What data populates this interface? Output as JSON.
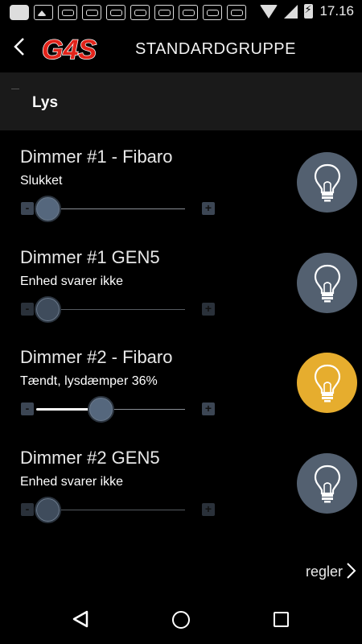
{
  "status_bar": {
    "time": "17.16",
    "icons": [
      "message-icon",
      "image-icon",
      "notification-icon",
      "notification-icon",
      "notification-icon",
      "notification-icon",
      "notification-icon",
      "notification-icon",
      "notification-icon",
      "notification-icon",
      "wifi-icon",
      "signal-icon",
      "battery-charging-icon"
    ]
  },
  "header": {
    "back_icon": "chevron-left-icon",
    "logo_text": "G4S",
    "title": "STANDARDGRUPPE"
  },
  "section": {
    "title": "Lys"
  },
  "devices": [
    {
      "name": "Dimmer #1 - Fibaro",
      "status": "Slukket",
      "level": 0,
      "enabled": true,
      "on": false
    },
    {
      "name": "Dimmer #1 GEN5",
      "status": "Enhed svarer ikke",
      "level": 0,
      "enabled": false,
      "on": false
    },
    {
      "name": "Dimmer #2 - Fibaro",
      "status": "Tændt, lysdæmper 36%",
      "level": 36,
      "enabled": true,
      "on": true
    },
    {
      "name": "Dimmer #2 GEN5",
      "status": "Enhed svarer ikke",
      "level": 0,
      "enabled": false,
      "on": false
    }
  ],
  "stepper": {
    "minus": "-",
    "plus": "+"
  },
  "colors": {
    "bulb_off": "#536070",
    "bulb_on": "#e6ad2e",
    "logo_red": "#e2231a"
  },
  "footer": {
    "rules_label": "regler"
  }
}
